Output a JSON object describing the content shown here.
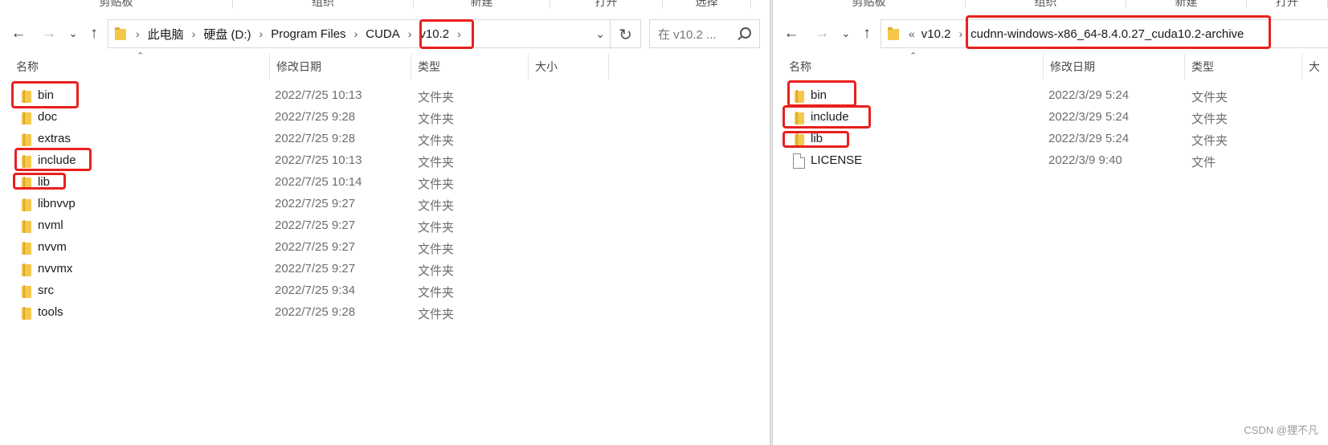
{
  "left": {
    "ribbon": [
      "剪贴板",
      "组织",
      "新建",
      "打开",
      "选择"
    ],
    "breadcrumb": [
      "此电脑",
      "硬盘 (D:)",
      "Program Files",
      "CUDA",
      "v10.2"
    ],
    "search_placeholder": "在 v10.2 ...",
    "columns": {
      "name": "名称",
      "date": "修改日期",
      "type": "类型",
      "size": "大小"
    },
    "items": [
      {
        "name": "bin",
        "date": "2022/7/25 10:13",
        "type": "文件夹"
      },
      {
        "name": "doc",
        "date": "2022/7/25 9:28",
        "type": "文件夹"
      },
      {
        "name": "extras",
        "date": "2022/7/25 9:28",
        "type": "文件夹"
      },
      {
        "name": "include",
        "date": "2022/7/25 10:13",
        "type": "文件夹"
      },
      {
        "name": "lib",
        "date": "2022/7/25 10:14",
        "type": "文件夹"
      },
      {
        "name": "libnvvp",
        "date": "2022/7/25 9:27",
        "type": "文件夹"
      },
      {
        "name": "nvml",
        "date": "2022/7/25 9:27",
        "type": "文件夹"
      },
      {
        "name": "nvvm",
        "date": "2022/7/25 9:27",
        "type": "文件夹"
      },
      {
        "name": "nvvmx",
        "date": "2022/7/25 9:27",
        "type": "文件夹"
      },
      {
        "name": "src",
        "date": "2022/7/25 9:34",
        "type": "文件夹"
      },
      {
        "name": "tools",
        "date": "2022/7/25 9:28",
        "type": "文件夹"
      }
    ]
  },
  "right": {
    "ribbon": [
      "剪贴板",
      "组织",
      "新建",
      "打开",
      "选择"
    ],
    "breadcrumb_overflow": "«",
    "breadcrumb": [
      "v10.2",
      "cudnn-windows-x86_64-8.4.0.27_cuda10.2-archive"
    ],
    "columns": {
      "name": "名称",
      "date": "修改日期",
      "type": "类型",
      "size": "大"
    },
    "items": [
      {
        "name": "bin",
        "date": "2022/3/29 5:24",
        "type": "文件夹"
      },
      {
        "name": "include",
        "date": "2022/3/29 5:24",
        "type": "文件夹"
      },
      {
        "name": "lib",
        "date": "2022/3/29 5:24",
        "type": "文件夹"
      },
      {
        "name": "LICENSE",
        "date": "2022/3/9 9:40",
        "type": "文件"
      }
    ]
  },
  "watermark": "CSDN @狸不凡",
  "colors": {
    "highlight": "#e8201d",
    "folder": "#f3c84b"
  }
}
